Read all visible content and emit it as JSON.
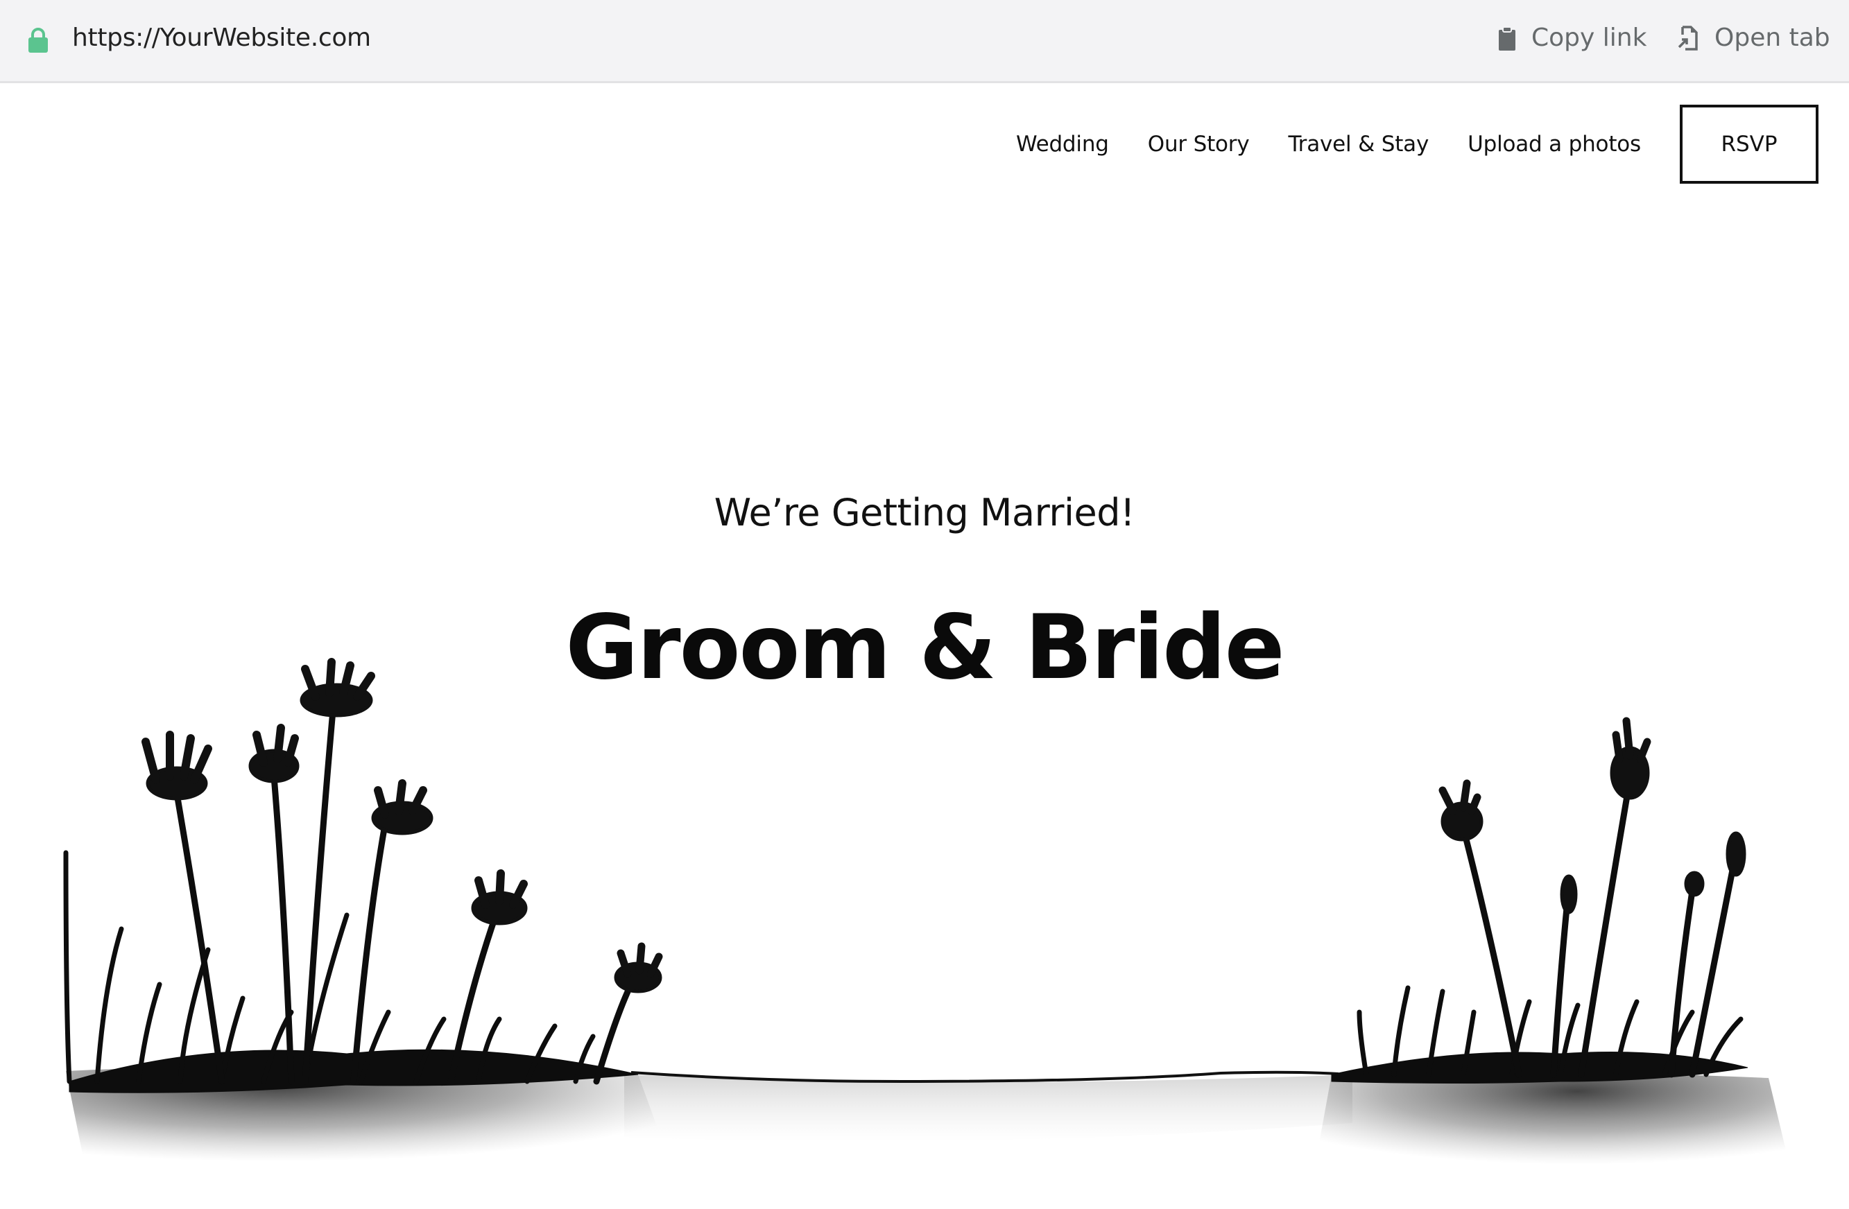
{
  "browser": {
    "url": "https://YourWebsite.com",
    "lock_icon": "lock-icon",
    "lock_color": "#5bc48f",
    "actions": [
      {
        "label": "Copy link",
        "icon": "clipboard-icon"
      },
      {
        "label": "Open tab",
        "icon": "open-tab-icon"
      }
    ]
  },
  "nav": {
    "links": [
      {
        "label": "Wedding"
      },
      {
        "label": "Our Story"
      },
      {
        "label": "Travel & Stay"
      },
      {
        "label": "Upload a photos"
      }
    ],
    "rsvp_label": "RSVP"
  },
  "hero": {
    "subtitle": "We’re Getting Married!",
    "title": "Groom & Bride",
    "illustration": "hand-drawn flowers and grass on ground"
  }
}
